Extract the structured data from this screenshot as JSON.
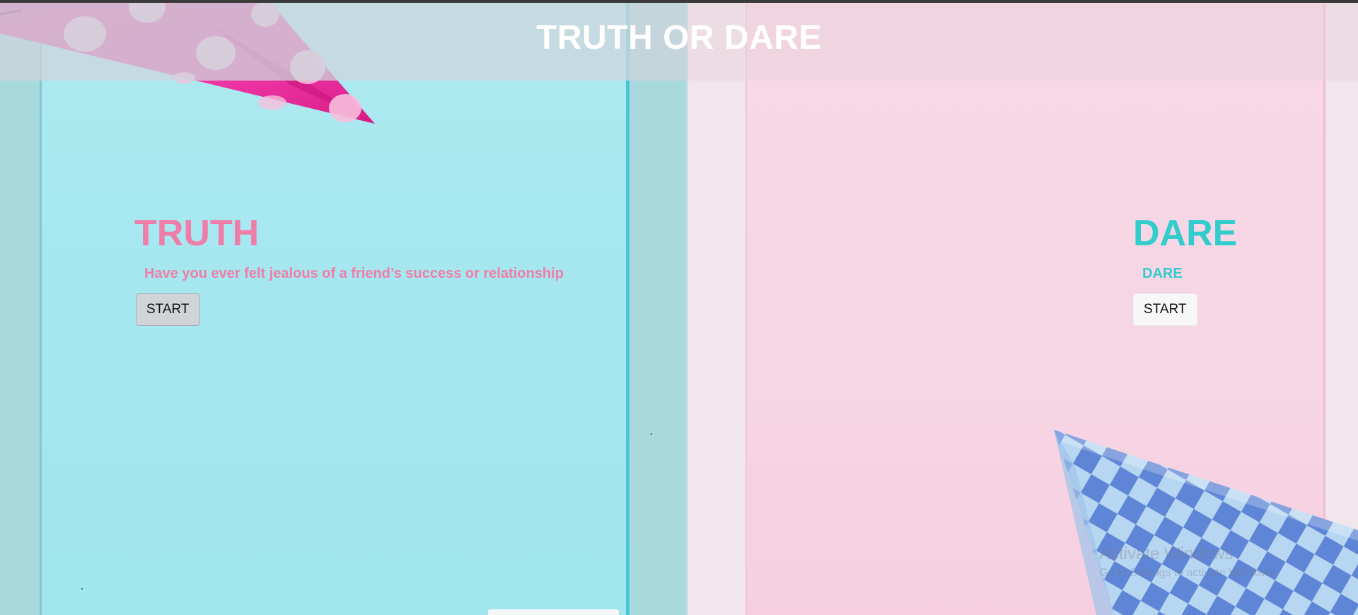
{
  "page": {
    "title": "TRUTH OR DARE"
  },
  "truth": {
    "heading": "TRUTH",
    "question": "Have you ever felt jealous of a friend’s success or relationship",
    "button_label": "START"
  },
  "dare": {
    "heading": "DARE",
    "challenge": "DARE",
    "button_label": "START"
  },
  "watermark": {
    "title": "Activate Windows",
    "subtitle": "Go to Settings to activate Windows."
  },
  "colors": {
    "truth_accent": "#f07ca8",
    "dare_accent": "#33cccc",
    "header_text": "#ffffff",
    "left_background": "#a5e7ef",
    "right_background": "#f7d7e5"
  },
  "icons": {
    "decor_top_left": "pink-party-hat-icon",
    "decor_bottom_right": "blue-party-hat-icon"
  }
}
